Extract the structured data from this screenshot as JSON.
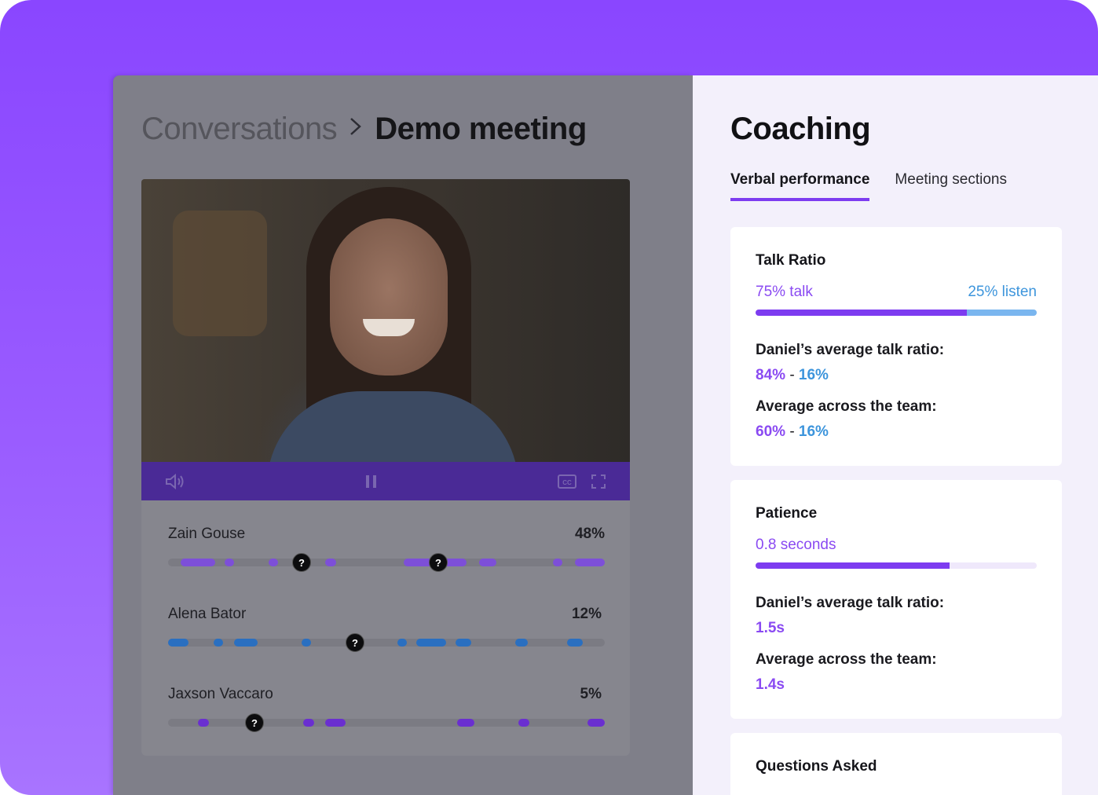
{
  "breadcrumb": {
    "parent": "Conversations",
    "current": "Demo meeting"
  },
  "video": {
    "controls": {
      "volume_icon": "speaker-icon",
      "pause_icon": "pause-icon",
      "cc_icon": "closed-captions-icon",
      "fullscreen_icon": "fullscreen-icon"
    }
  },
  "speakers": [
    {
      "name": "Zain Gouse",
      "percent": "48%",
      "color": "#7d4fd8",
      "share": 0.48
    },
    {
      "name": "Alena Bator",
      "percent": "12%",
      "color": "#2a6fc0",
      "share": 0.12
    },
    {
      "name": "Jaxson Vaccaro",
      "percent": "5%",
      "color": "#6a2fd0",
      "share": 0.05
    }
  ],
  "coaching": {
    "title": "Coaching",
    "tabs": [
      {
        "label": "Verbal performance",
        "active": true
      },
      {
        "label": "Meeting sections",
        "active": false
      }
    ],
    "talk_ratio": {
      "title": "Talk Ratio",
      "talk_label": "75% talk",
      "listen_label": "25% listen",
      "talk_fraction": 0.75,
      "daniel_label": "Daniel’s average talk ratio:",
      "daniel_talk": "84%",
      "daniel_listen": "16%",
      "team_label": "Average across the team:",
      "team_talk": "60%",
      "team_listen": "16%",
      "separator": "-"
    },
    "patience": {
      "title": "Patience",
      "value_label": "0.8 seconds",
      "fill_fraction": 0.69,
      "daniel_label": "Daniel’s average talk ratio:",
      "daniel_value": "1.5s",
      "team_label": "Average across the team:",
      "team_value": "1.4s"
    },
    "questions": {
      "title": "Questions Asked"
    }
  },
  "colors": {
    "brand_purple": "#8a46ff",
    "accent_purple": "#7d3cf0",
    "accent_blue": "#3d95dc",
    "listen_blue": "#7ab6ef"
  }
}
